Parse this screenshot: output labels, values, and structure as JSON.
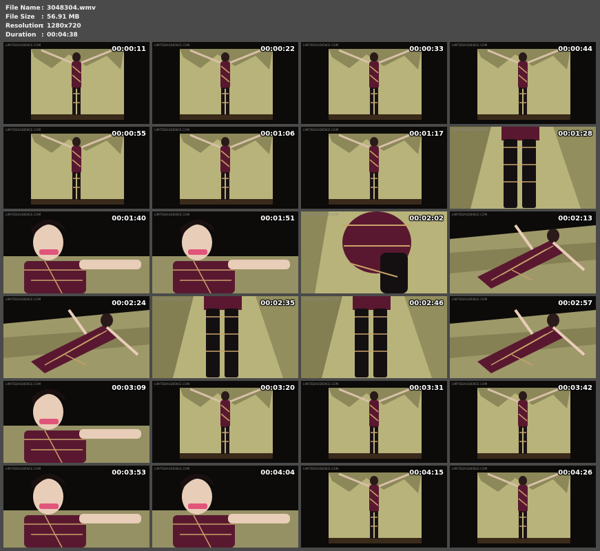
{
  "file_info": {
    "rows": [
      {
        "key": "File Name",
        "value": "3048304.wmv"
      },
      {
        "key": "File Size",
        "value": "56.91 MB"
      },
      {
        "key": "Resolution",
        "value": "1280x720"
      },
      {
        "key": "Duration",
        "value": "00:04:38"
      }
    ],
    "separator": ":"
  },
  "thumbnails": [
    {
      "time": "00:00:11",
      "scene": "wide"
    },
    {
      "time": "00:00:22",
      "scene": "wide"
    },
    {
      "time": "00:00:33",
      "scene": "wide"
    },
    {
      "time": "00:00:44",
      "scene": "wide"
    },
    {
      "time": "00:00:55",
      "scene": "wide"
    },
    {
      "time": "00:01:06",
      "scene": "wide"
    },
    {
      "time": "00:01:17",
      "scene": "wide"
    },
    {
      "time": "00:01:28",
      "scene": "boots"
    },
    {
      "time": "00:01:40",
      "scene": "closeup"
    },
    {
      "time": "00:01:51",
      "scene": "closeup"
    },
    {
      "time": "00:02:02",
      "scene": "legs"
    },
    {
      "time": "00:02:13",
      "scene": "lying"
    },
    {
      "time": "00:02:24",
      "scene": "lying"
    },
    {
      "time": "00:02:35",
      "scene": "boots"
    },
    {
      "time": "00:02:46",
      "scene": "boots"
    },
    {
      "time": "00:02:57",
      "scene": "lying"
    },
    {
      "time": "00:03:09",
      "scene": "closeup"
    },
    {
      "time": "00:03:20",
      "scene": "wide"
    },
    {
      "time": "00:03:31",
      "scene": "wide"
    },
    {
      "time": "00:03:42",
      "scene": "wide"
    },
    {
      "time": "00:03:53",
      "scene": "closeup"
    },
    {
      "time": "00:04:04",
      "scene": "closeup"
    },
    {
      "time": "00:04:15",
      "scene": "wide"
    },
    {
      "time": "00:04:26",
      "scene": "wide"
    }
  ],
  "watermark": "LIMITEDAUDIENCE.COM",
  "colors": {
    "background": "#4a4a4a",
    "backdrop": "#b8b37a",
    "backdrop_shadow": "#6e6a42",
    "outfit": "#5a1830",
    "rope": "#c9a36a"
  }
}
